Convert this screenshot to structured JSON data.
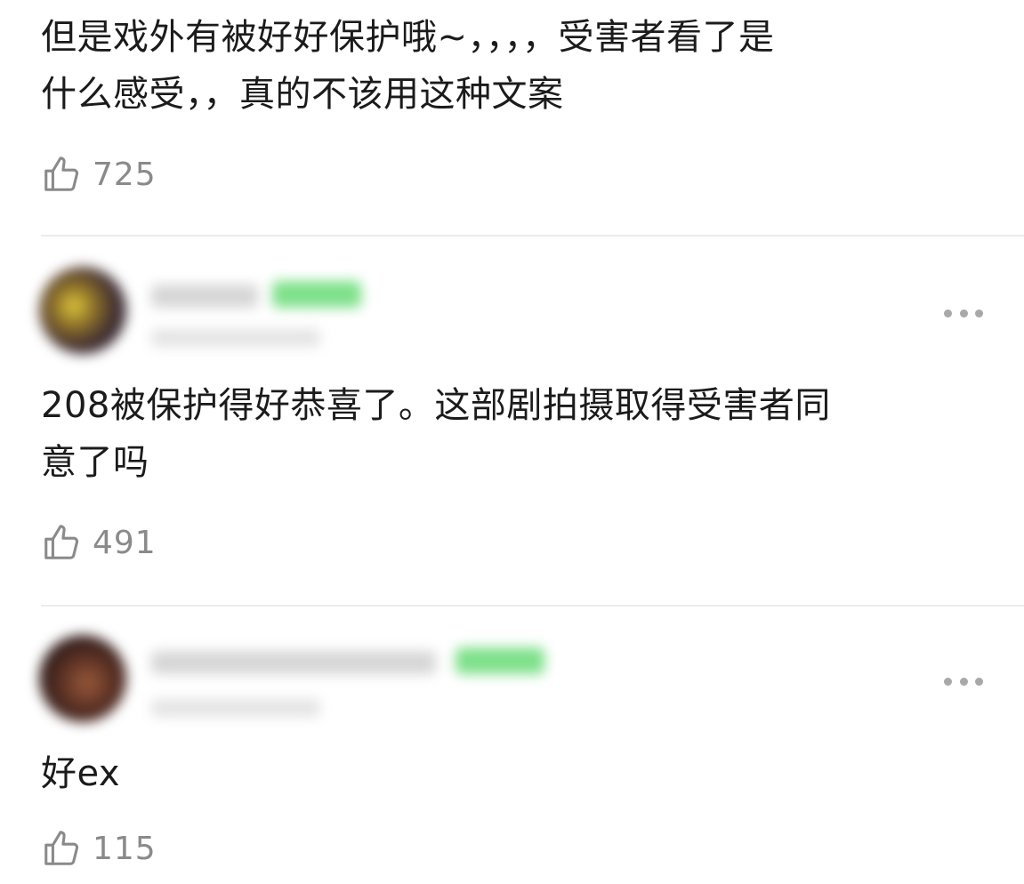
{
  "comments": [
    {
      "text": "但是戏外有被好好保护哦~，，，，受害者看了是\n什么感受，，真的不该用这种文案",
      "like_count": "725"
    },
    {
      "text": "208被保护得好恭喜了。这部剧拍摄取得受害者同\n意了吗",
      "like_count": "491"
    },
    {
      "text": "好ex",
      "like_count": "115"
    }
  ],
  "icons": {
    "like": "thumbs-up-icon",
    "more": "more-horizontal-icon"
  },
  "colors": {
    "text": "#1b1b1b",
    "like_count": "#8a8a8a",
    "divider": "#ececec",
    "badge": "#7ee08a"
  }
}
